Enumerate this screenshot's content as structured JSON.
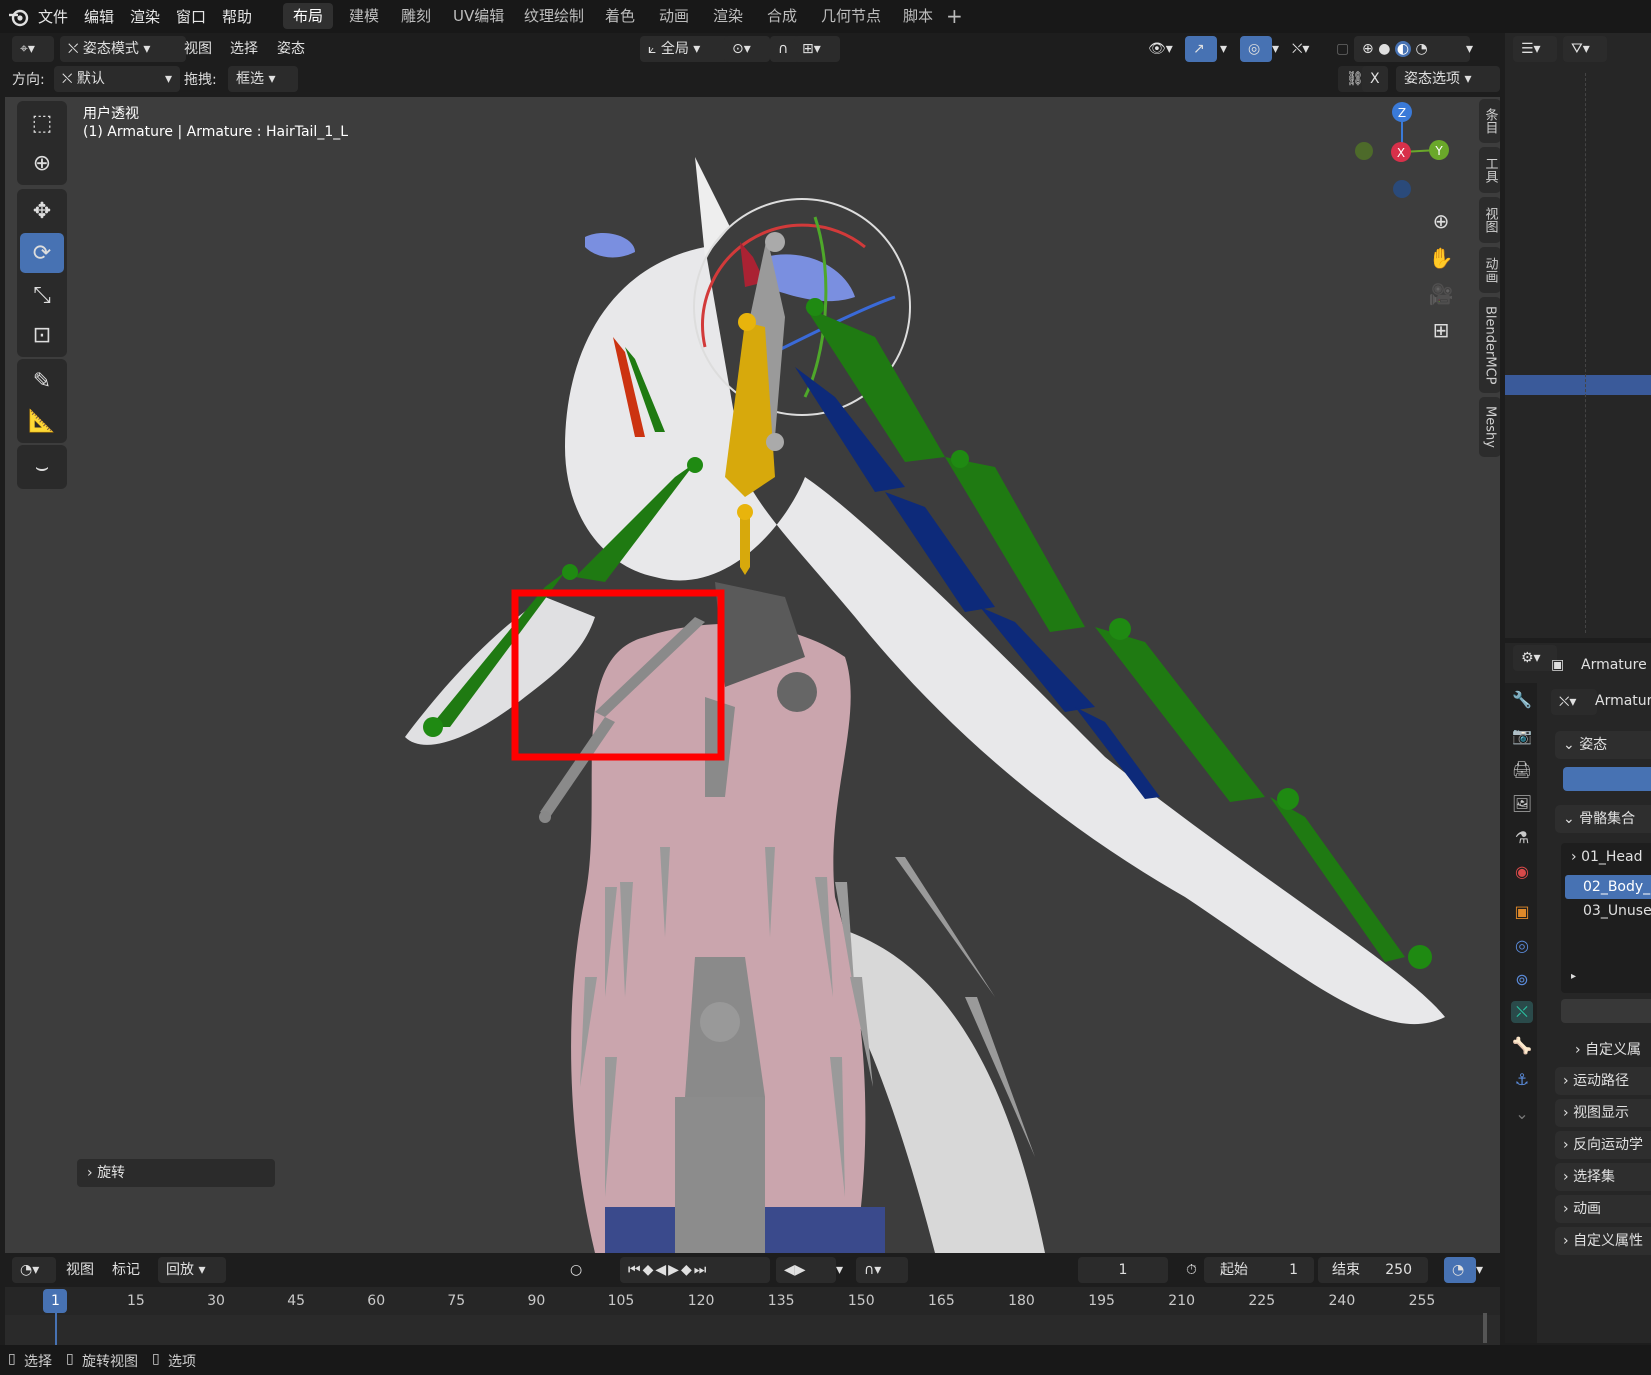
{
  "menu": {
    "file": "文件",
    "edit": "编辑",
    "render": "渲染",
    "window": "窗口",
    "help": "帮助"
  },
  "workspaces": [
    "布局",
    "建模",
    "雕刻",
    "UV编辑",
    "纹理绘制",
    "着色",
    "动画",
    "渲染",
    "合成",
    "几何节点",
    "脚本"
  ],
  "viewport_header": {
    "mode": "姿态模式",
    "view": "视图",
    "select": "选择",
    "pose": "姿态",
    "transform_orientation": "全局",
    "orientation_label": "方向:",
    "orientation_value": "默认",
    "drag_label": "拖拽:",
    "drag_value": "框选",
    "x_label": "X",
    "pose_options": "姿态选项"
  },
  "viewport": {
    "view_name": "用户透视",
    "object_info": "(1) Armature | Armature : HairTail_1_L",
    "last_op": "旋转",
    "gizmo": {
      "z": "Z",
      "x": "X",
      "y": "Y"
    }
  },
  "sidebar_tabs": [
    "条目",
    "工具",
    "视图",
    "动画",
    "BlenderMCP",
    "Meshy"
  ],
  "properties": {
    "object_name": "Armature",
    "data_name": "Armatur",
    "pose_section": "姿态",
    "bone_collections_section": "骨骼集合",
    "collections": [
      "01_Head",
      "02_Body_",
      "03_Unuse"
    ],
    "custom_props_sub": "自定义属",
    "sections": [
      "运动路径",
      "视图显示",
      "反向运动学",
      "选择集",
      "动画",
      "自定义属性"
    ]
  },
  "timeline": {
    "view": "视图",
    "marker": "标记",
    "playback": "回放",
    "current_frame": "1",
    "start_label": "起始",
    "start_value": "1",
    "end_label": "结束",
    "end_value": "250",
    "ruler": [
      "1",
      "15",
      "30",
      "45",
      "60",
      "75",
      "90",
      "105",
      "120",
      "135",
      "150",
      "165",
      "180",
      "195",
      "210",
      "225",
      "240",
      "255"
    ]
  },
  "status": {
    "select": "选择",
    "rotate_view": "旋转视图",
    "options": "选项"
  },
  "colors": {
    "accent": "#4772b3",
    "highlight_box": "#ff0000",
    "bone_green": "#1f7a12",
    "bone_blue": "#0d2a7a",
    "bone_yellow": "#d7a90c"
  }
}
